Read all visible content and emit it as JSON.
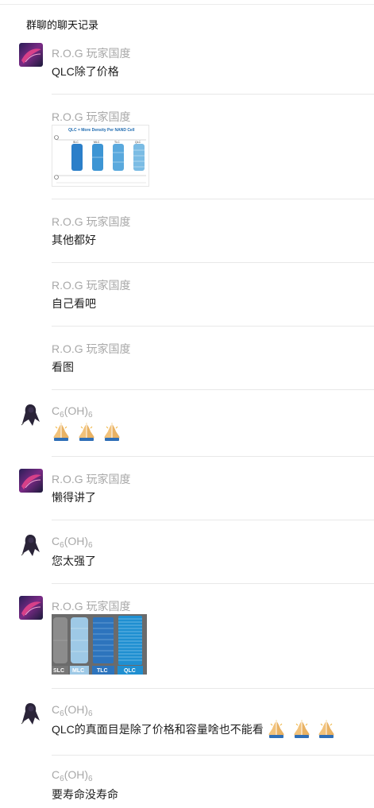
{
  "header": {
    "title": "群聊的聊天记录"
  },
  "users": {
    "rog": "R.O.G 玩家国度",
    "c6_base": "C",
    "c6_sub": "6",
    "c6_mid": "(OH)",
    "c6_sub2": "6"
  },
  "messages": [
    {
      "sender": "R.O.G 玩家国度",
      "text": "QLC除了价格"
    },
    {
      "sender": "R.O.G 玩家国度",
      "image": "qlc-density-chart"
    },
    {
      "sender": "R.O.G 玩家国度",
      "text": "其他都好"
    },
    {
      "sender": "R.O.G 玩家国度",
      "text": "自己看吧"
    },
    {
      "sender": "R.O.G 玩家国度",
      "text": "看图"
    },
    {
      "sender": "C6(OH)6",
      "emoji": "praying-hands-icon x3"
    },
    {
      "sender": "R.O.G 玩家国度",
      "text": "懒得讲了"
    },
    {
      "sender": "C6(OH)6",
      "text": "您太强了"
    },
    {
      "sender": "R.O.G 玩家国度",
      "image": "slc-mlc-tlc-qlc-chart"
    },
    {
      "sender": "C6(OH)6",
      "text": "QLC的真面目是除了价格和容量啥也不能看"
    },
    {
      "sender": "C6(OH)6",
      "text": "要寿命没寿命"
    }
  ],
  "image1": {
    "title": "QLC = More Density Per NAND Cell",
    "columns": [
      "SLC",
      "MLC",
      "TLC",
      "QLC"
    ]
  },
  "image2": {
    "labels": [
      "SLC",
      "MLC",
      "TLC",
      "QLC"
    ]
  },
  "colors": {
    "sender": "#a8a8a8",
    "separator": "#e8e8e8",
    "rog_pink": "#d23a7a",
    "slc_blue": "#3a96d6"
  }
}
